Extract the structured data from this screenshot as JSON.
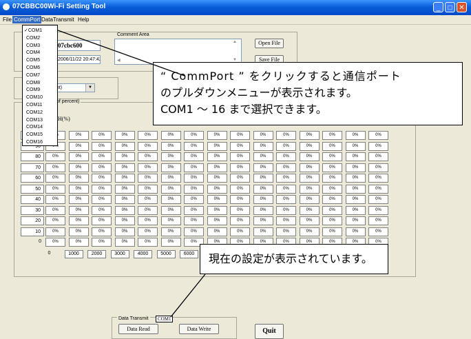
{
  "window": {
    "title": "07CBBC00Wi-Fi Setting Tool"
  },
  "menu": {
    "file": "File",
    "commport": "CommPort",
    "datatransmit": "DataTransmit",
    "help": "Help"
  },
  "dropdown": {
    "items": [
      "COM1",
      "COM2",
      "COM3",
      "COM4",
      "COM5",
      "COM6",
      "COM7",
      "COM8",
      "COM9",
      "COM10",
      "COM11",
      "COM12",
      "COM13",
      "COM14",
      "COM15",
      "COM16"
    ],
    "checked_index": 0
  },
  "info": {
    "name_value": "07cbc600",
    "datetime_value": "2006/11/22 20:47:42"
  },
  "comment": {
    "label": "Comment Area"
  },
  "buttons": {
    "open_file": "Open File",
    "save_file": "Save File",
    "data_read": "Data Read",
    "data_write": "Data Write",
    "quit": "Quit"
  },
  "select": {
    "value": "(percent)"
  },
  "grid": {
    "partial_label": "of percent)",
    "axis_label": "H(%)",
    "rows": [
      "100",
      "90",
      "80",
      "70",
      "60",
      "50",
      "40",
      "30",
      "20",
      "10",
      "0"
    ],
    "cols": [
      "0",
      "1000",
      "2000",
      "3000",
      "4000",
      "5000",
      "6000"
    ],
    "cell": "0%"
  },
  "transmit": {
    "label": "Data Transmit",
    "port": "COM1"
  },
  "callouts": {
    "commport_lines": [
      "“ CommPort ” をクリックすると通信ポート",
      "のプルダウンメニューが表示されます。",
      "COM1 ～ 16 まで選択できます。"
    ],
    "current": "現在の設定が表示されています。"
  }
}
